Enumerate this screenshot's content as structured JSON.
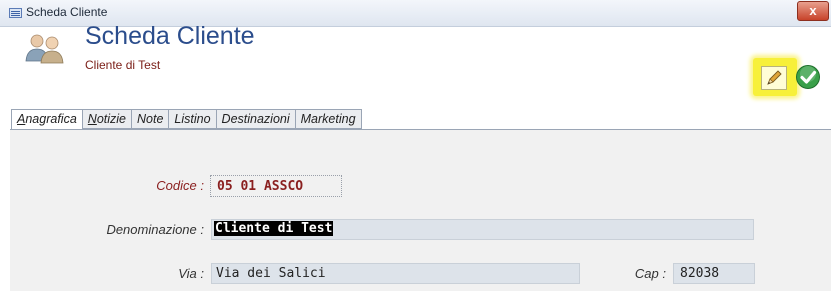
{
  "window": {
    "title": "Scheda Cliente",
    "close_label": "x",
    "icon": "form-app-icon"
  },
  "header": {
    "title": "Scheda Cliente",
    "subtitle": "Cliente di Test",
    "avatar_icon": "users-icon",
    "edit_icon": "pencil-icon",
    "confirm_icon": "checkmark-icon",
    "highlight_color": "#f7f03a"
  },
  "tabs": [
    {
      "mnemonic": "A",
      "rest": "nagrafica",
      "active": true
    },
    {
      "mnemonic": "N",
      "rest": "otizie",
      "active": false
    },
    {
      "mnemonic": "",
      "rest": "Note",
      "active": false
    },
    {
      "mnemonic": "",
      "rest": "Listino",
      "active": false
    },
    {
      "mnemonic": "",
      "rest": "Destinazioni",
      "active": false
    },
    {
      "mnemonic": "",
      "rest": "Marketing",
      "active": false
    }
  ],
  "form": {
    "codice": {
      "label": "Codice :",
      "value": "05 01 ASSCO",
      "label_color": "#8a1f1f"
    },
    "denominazione": {
      "label": "Denominazione :",
      "value": "Cliente di Test",
      "selected": true
    },
    "via": {
      "label": "Via :",
      "value": "Via dei Salici"
    },
    "cap": {
      "label": "Cap :",
      "value": "82038"
    }
  }
}
